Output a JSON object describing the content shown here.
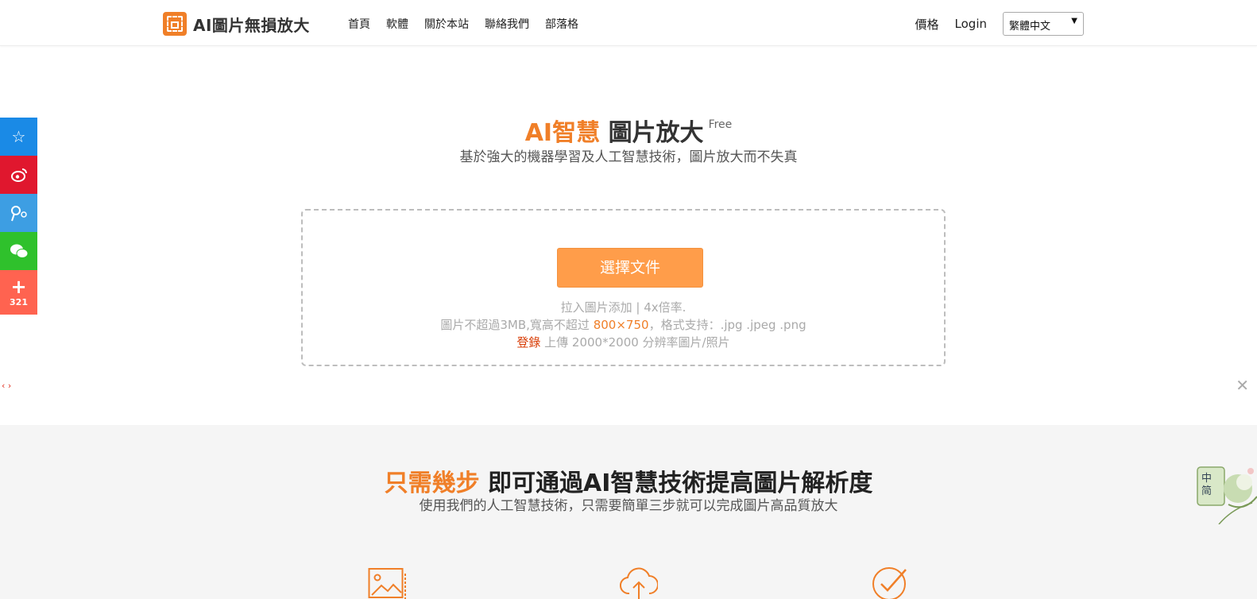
{
  "header": {
    "logo_text": "AI圖片無損放大",
    "nav": [
      "首頁",
      "軟體",
      "關於本站",
      "聯絡我們",
      "部落格"
    ],
    "price": "價格",
    "login": "Login",
    "language": "繁體中文"
  },
  "social": {
    "share_count": "321",
    "icons": [
      "qzone-icon",
      "weibo-icon",
      "tencent-weibo-icon",
      "wechat-icon",
      "plus-icon"
    ],
    "colors": [
      "#1a8ae6",
      "#e0172e",
      "#3d9ee3",
      "#2fc12c",
      "#ff6350"
    ]
  },
  "hero": {
    "title_accent": "AI智慧",
    "title_main": "圖片放大",
    "free": "Free",
    "subtitle": "基於強大的機器學習及人工智慧技術，圖片放大而不失真"
  },
  "upload": {
    "button": "選擇文件",
    "hint1": "拉入圖片添加 | 4x倍率.",
    "hint2_prefix": "圖片不超過3MB,寬高不超过 ",
    "hint2_size": "800×750",
    "hint2_suffix": "，格式支持：.jpg .jpeg .png",
    "hint3_login": "登錄",
    "hint3_text": " 上傳 2000*2000 分辨率圖片/照片"
  },
  "steps": {
    "title_accent": "只需幾步",
    "title_main": " 即可通過AI智慧技術提高圖片解析度",
    "subtitle": "使用我們的人工智慧技術，只需要簡單三步就可以完成圖片高品質放大"
  },
  "badge": {
    "line1": "中",
    "line2": "简"
  },
  "colors": {
    "accent": "#f07f28",
    "button": "#ff9d4a"
  }
}
